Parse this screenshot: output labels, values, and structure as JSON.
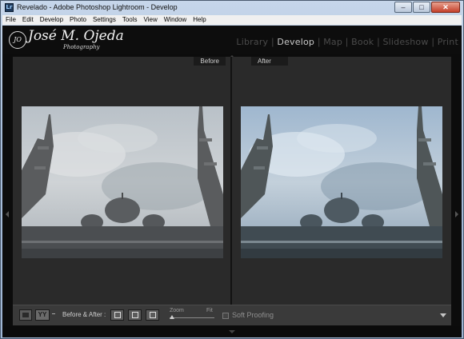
{
  "window": {
    "title": "Revelado - Adobe Photoshop Lightroom - Develop",
    "app_icon_glyph": "Lr",
    "controls": {
      "minimize": "–",
      "maximize": "□",
      "close": "✕"
    }
  },
  "menu": [
    "File",
    "Edit",
    "Develop",
    "Photo",
    "Settings",
    "Tools",
    "View",
    "Window",
    "Help"
  ],
  "identity_plate": {
    "badge": "JO",
    "name": "José M. Ojeda",
    "tagline": "Photography"
  },
  "modules": [
    {
      "label": "Library",
      "active": false
    },
    {
      "label": "Develop",
      "active": true
    },
    {
      "label": "Map",
      "active": false
    },
    {
      "label": "Book",
      "active": false
    },
    {
      "label": "Slideshow",
      "active": false
    },
    {
      "label": "Print",
      "active": false
    }
  ],
  "panes": {
    "before_label": "Before",
    "after_label": "After"
  },
  "toolbar": {
    "before_after_glyph": "YY",
    "view_label": "Before & After :",
    "zoom_label": "Zoom",
    "zoom_fit_label": "Fit",
    "zoom_level": 0,
    "soft_proofing_label": "Soft Proofing",
    "soft_proofing_checked": false
  },
  "colors": {
    "accent_active": "#c8c8c8",
    "inactive": "#4b4b4b",
    "panel": "#2a2a2a"
  }
}
